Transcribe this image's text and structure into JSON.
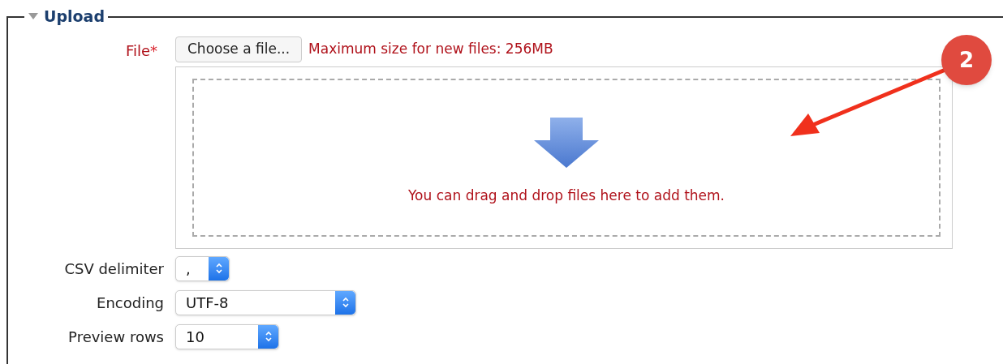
{
  "section": {
    "title": "Upload",
    "expanded": true
  },
  "file_field": {
    "label": "File",
    "required_mark": "*",
    "button": "Choose a file...",
    "size_note": "Maximum size for new files: 256MB",
    "drop_message": "You can drag and drop files here to add them."
  },
  "selects": [
    {
      "label": "CSV delimiter",
      "value": ","
    },
    {
      "label": "Encoding",
      "value": "UTF-8"
    },
    {
      "label": "Preview rows",
      "value": "10"
    }
  ],
  "annotation": {
    "number": "2"
  }
}
